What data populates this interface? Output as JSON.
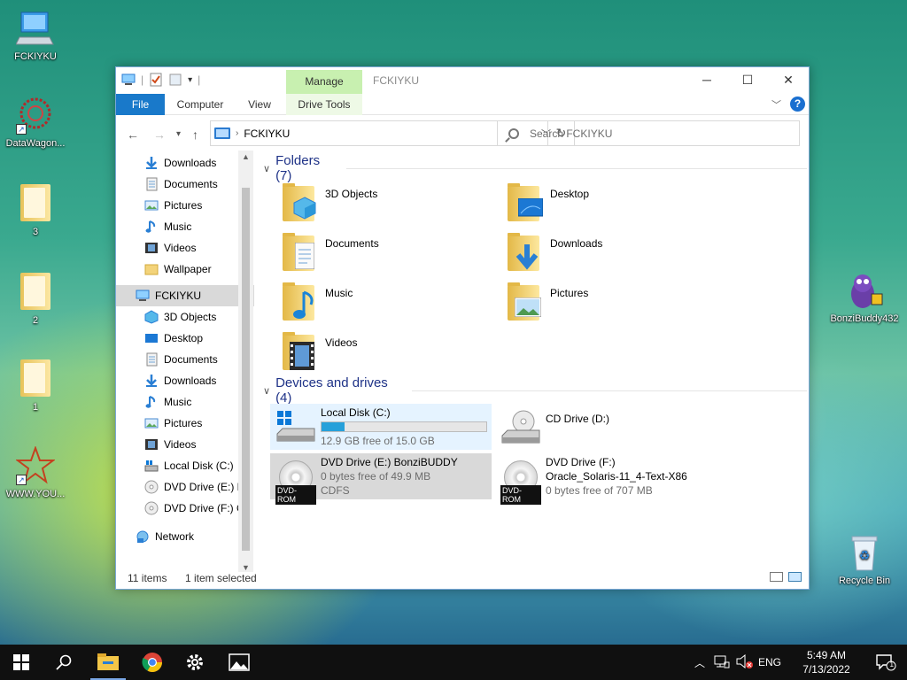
{
  "desktop": {
    "icons": [
      {
        "label": "FCKIYKU"
      },
      {
        "label": "DataWagon..."
      },
      {
        "label": "3"
      },
      {
        "label": "2"
      },
      {
        "label": "1"
      },
      {
        "label": "WWW.YOU..."
      },
      {
        "label": "BonziBuddy432"
      },
      {
        "label": "Recycle Bin"
      }
    ]
  },
  "window": {
    "title": "FCKIYKU",
    "manage_label": "Manage",
    "ribbon_tabs": {
      "file": "File",
      "computer": "Computer",
      "view": "View",
      "drive_tools": "Drive Tools"
    },
    "controls": {
      "minimize": "─",
      "maximize": "☐",
      "close": "✕"
    },
    "help": "?"
  },
  "address": {
    "crumb": "FCKIYKU",
    "search_placeholder": "Search FCKIYKU"
  },
  "nav": {
    "quick_access": [
      {
        "label": "Downloads",
        "icon": "download-icon",
        "pinned": true
      },
      {
        "label": "Documents",
        "icon": "document-icon",
        "pinned": true
      },
      {
        "label": "Pictures",
        "icon": "pictures-icon",
        "pinned": true
      },
      {
        "label": "Music",
        "icon": "music-icon",
        "pinned": false
      },
      {
        "label": "Videos",
        "icon": "videos-icon",
        "pinned": false
      },
      {
        "label": "Wallpaper",
        "icon": "folder-icon",
        "pinned": false
      }
    ],
    "this_pc": "FCKIYKU",
    "pc_children": [
      {
        "label": "3D Objects",
        "icon": "3d-objects-icon"
      },
      {
        "label": "Desktop",
        "icon": "desktop-icon"
      },
      {
        "label": "Documents",
        "icon": "document-icon"
      },
      {
        "label": "Downloads",
        "icon": "download-icon"
      },
      {
        "label": "Music",
        "icon": "music-icon"
      },
      {
        "label": "Pictures",
        "icon": "pictures-icon"
      },
      {
        "label": "Videos",
        "icon": "videos-icon"
      },
      {
        "label": "Local Disk (C:)",
        "icon": "local-disk-icon"
      },
      {
        "label": "DVD Drive (E:) Bo",
        "icon": "dvd-drive-icon"
      },
      {
        "label": "DVD Drive (F:) O",
        "icon": "dvd-drive-icon"
      }
    ],
    "network": "Network"
  },
  "content": {
    "folders_header": "Folders (7)",
    "folders": [
      {
        "label": "3D Objects",
        "icon": "3d-objects-icon"
      },
      {
        "label": "Desktop",
        "icon": "desktop-icon"
      },
      {
        "label": "Documents",
        "icon": "document-icon"
      },
      {
        "label": "Downloads",
        "icon": "download-icon"
      },
      {
        "label": "Music",
        "icon": "music-icon"
      },
      {
        "label": "Pictures",
        "icon": "pictures-icon"
      },
      {
        "label": "Videos",
        "icon": "videos-icon"
      }
    ],
    "devices_header": "Devices and drives (4)",
    "drives": [
      {
        "name": "Local Disk (C:)",
        "sub1": "12.9 GB free of 15.0 GB",
        "sub2": "",
        "used_fraction": 0.14,
        "badge": ""
      },
      {
        "name": "CD Drive (D:)",
        "sub1": "",
        "sub2": "",
        "badge": ""
      },
      {
        "name": "DVD Drive (E:) BonziBUDDY",
        "sub1": "0 bytes free of 49.9 MB",
        "sub2": "CDFS",
        "badge": "DVD-ROM"
      },
      {
        "name": "DVD Drive (F:)",
        "sub1": "Oracle_Solaris-11_4-Text-X86",
        "sub2": "0 bytes free of 707 MB",
        "badge": "DVD-ROM"
      }
    ]
  },
  "status": {
    "items": "11 items",
    "selected": "1 item selected"
  },
  "taskbar": {
    "lang": "ENG",
    "time": "5:49 AM",
    "date": "7/13/2022",
    "notifications": "1"
  }
}
